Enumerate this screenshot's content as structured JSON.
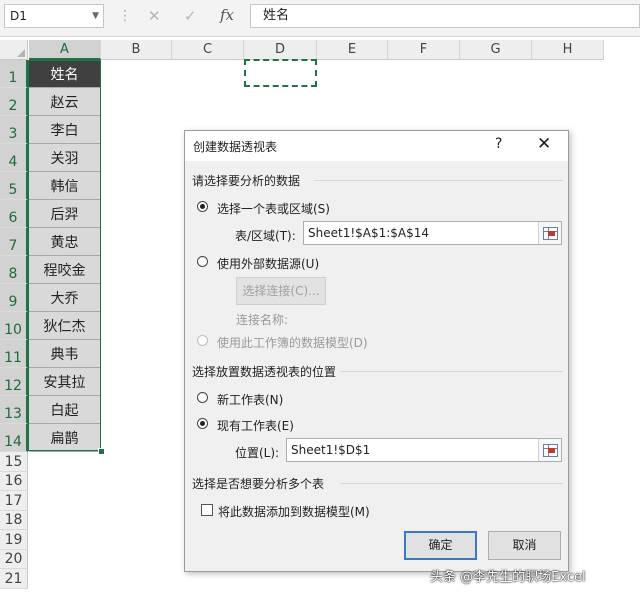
{
  "formula_bar": {
    "name_box": "D1",
    "cancel_icon": "✕",
    "enter_icon": "✓",
    "fx_label": "fx",
    "content": "姓名"
  },
  "columns": [
    "A",
    "B",
    "C",
    "D",
    "E",
    "F",
    "G",
    "H"
  ],
  "rows": [
    "1",
    "2",
    "3",
    "4",
    "5",
    "6",
    "7",
    "8",
    "9",
    "10",
    "11",
    "12",
    "13",
    "14",
    "15",
    "16",
    "17",
    "18",
    "19",
    "20",
    "21"
  ],
  "column_a_values": [
    "姓名",
    "赵云",
    "李白",
    "关羽",
    "韩信",
    "后羿",
    "黄忠",
    "程咬金",
    "大乔",
    "狄仁杰",
    "典韦",
    "安其拉",
    "白起",
    "扁鹊"
  ],
  "dialog": {
    "title": "创建数据透视表",
    "help": "?",
    "close": "✕",
    "section1": "请选择要分析的数据",
    "opt_select_table": "选择一个表或区域(S)",
    "table_range_label": "表/区域(T):",
    "table_range_value": "Sheet1!$A$1:$A$14",
    "opt_external": "使用外部数据源(U)",
    "choose_connection": "选择连接(C)...",
    "connection_name_label": "连接名称:",
    "opt_data_model": "使用此工作簿的数据模型(D)",
    "section2": "选择放置数据透视表的位置",
    "opt_new_sheet": "新工作表(N)",
    "opt_existing_sheet": "现有工作表(E)",
    "location_label": "位置(L):",
    "location_value": "Sheet1!$D$1",
    "section3": "选择是否想要分析多个表",
    "add_to_model": "将此数据添加到数据模型(M)",
    "ok": "确定",
    "cancel": "取消"
  },
  "watermark": "头条 @李先生的职场Excel",
  "colors": {
    "excel_green": "#217346",
    "header_cell": "#404040",
    "data_cell": "#d9d9d9"
  }
}
